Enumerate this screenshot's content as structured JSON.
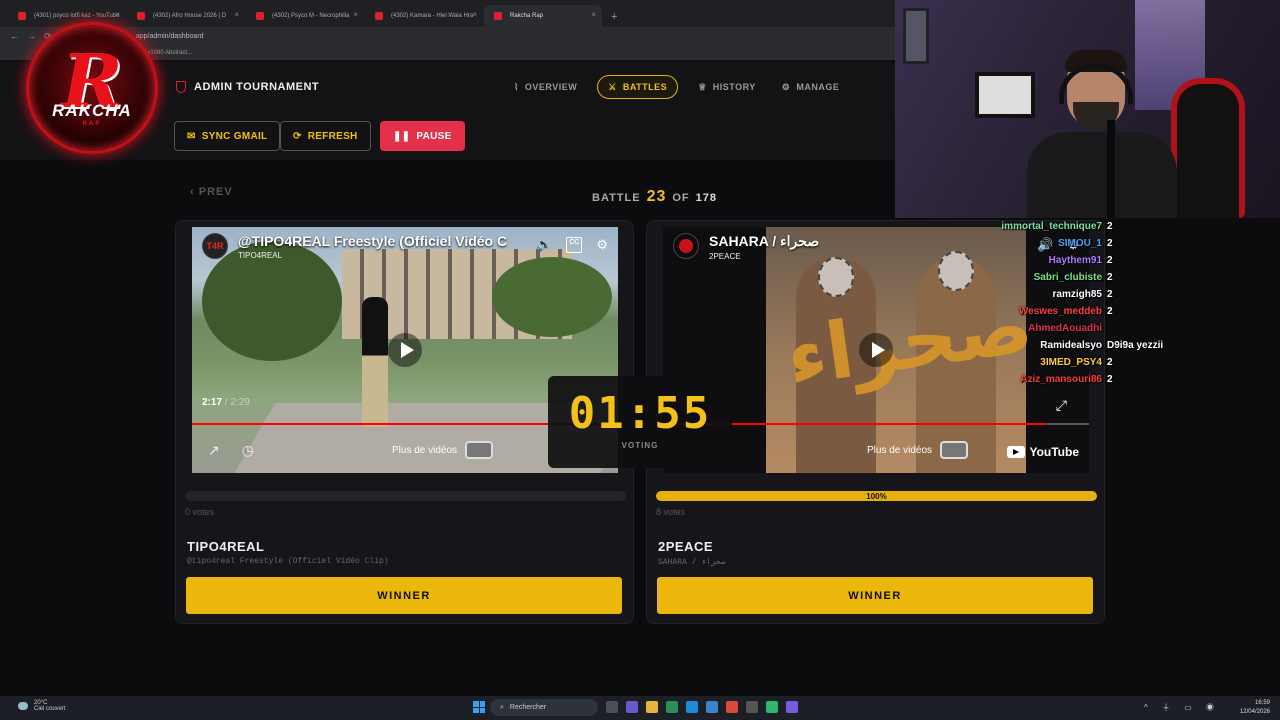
{
  "browser": {
    "tabs": [
      {
        "label": "(4301) psyco lotfi kaz - YouTube"
      },
      {
        "label": "(4302) Afro House 2026 | D"
      },
      {
        "label": "(4302) Psyco M - Necrophilia"
      },
      {
        "label": "(4302) Kamara - Hlel Wala Hra"
      },
      {
        "label": "Rakcha Rap",
        "active": true
      }
    ],
    "new_tab": "+",
    "address": "...app/admin/dashboard",
    "bookmark": "1x1080 Abstract..."
  },
  "logo": {
    "letter": "R",
    "name": "RAKCHA",
    "sub": "RAP"
  },
  "header": {
    "admin_title": "ADMIN TOURNAMENT",
    "nav": [
      {
        "label": "OVERVIEW",
        "icon": "activity-icon"
      },
      {
        "label": "BATTLES",
        "icon": "swords-icon",
        "active": true
      },
      {
        "label": "HISTORY",
        "icon": "trophy-icon"
      },
      {
        "label": "MANAGE",
        "icon": "gear-icon"
      }
    ]
  },
  "actions": {
    "sync": "SYNC GMAIL",
    "refresh": "REFRESH",
    "pause": "PAUSE"
  },
  "battle": {
    "prev": "PREV",
    "label": "BATTLE",
    "current": "23",
    "of": "OF",
    "total": "178"
  },
  "timer": {
    "value": "01:55",
    "label": "VOTING"
  },
  "contestants": [
    {
      "video_title": "@TIPO4REAL Freestyle (Officiel Vidéo C",
      "channel": "TIPO4REAL",
      "channel_badge": "T4R",
      "time_current": "2:17",
      "time_total": "/ 2:29",
      "more_videos": "Plus de vidéos",
      "vote_percent": 0,
      "votes_text": "0 votes",
      "name": "TIPO4REAL",
      "subtitle": "@tipo4real Freestyle (Officiel Vidéo Clip)",
      "winner": "WINNER"
    },
    {
      "video_title": "SAHARA / صحراء",
      "channel": "2PEACE",
      "more_videos": "Plus de vidéos",
      "yt_brand": "YouTube",
      "vote_percent": 100,
      "bar_label": "100%",
      "votes_text": "8 votes",
      "name": "2PEACE",
      "subtitle": "SAHARA / صحراء",
      "winner": "WINNER"
    }
  ],
  "chat": [
    {
      "user": "immortal_technique7",
      "msg": "2",
      "color": "#7ee0a0"
    },
    {
      "user": "SIMOU_1",
      "msg": "2",
      "color": "#4aa0ff"
    },
    {
      "user": "Haythem91",
      "msg": "2",
      "color": "#b07cff"
    },
    {
      "user": "Sabri_clubiste",
      "msg": "2",
      "color": "#7ee08a"
    },
    {
      "user": "ramzigh85",
      "msg": "2",
      "color": "#ffffff"
    },
    {
      "user": "Weswes_meddeb",
      "msg": "2",
      "color": "#ff4040"
    },
    {
      "user": "AhmedAouadhi",
      "msg": "",
      "color": "#e0324a"
    },
    {
      "user": "Ramidealsyo",
      "msg": "D9i9a yezzii",
      "color": "#ffffff"
    },
    {
      "user": "3IMED_PSY4",
      "msg": "2",
      "color": "#ffcc33"
    },
    {
      "user": "Aziz_mansouri86",
      "msg": "2",
      "color": "#ff3a3a"
    }
  ],
  "taskbar": {
    "temp": "20°C",
    "weather": "Ciel couvert",
    "search": "Rechercher",
    "time": "16:59",
    "date": "12/04/2026"
  }
}
